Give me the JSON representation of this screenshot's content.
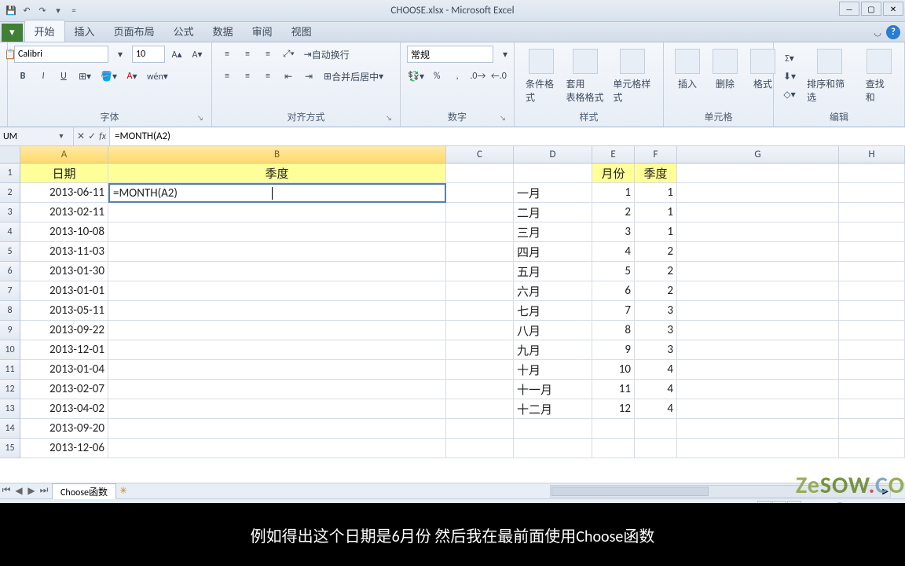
{
  "title": "CHOOSE.xlsx - Microsoft Excel",
  "tabs": {
    "file": "文件",
    "home": "开始",
    "insert": "插入",
    "layout": "页面布局",
    "formulas": "公式",
    "data": "数据",
    "review": "审阅",
    "view": "视图"
  },
  "ribbon": {
    "font": {
      "name": "Calibri",
      "size": "10",
      "label": "字体"
    },
    "align": {
      "wrap": "自动换行",
      "merge": "合并后居中",
      "label": "对齐方式"
    },
    "number": {
      "format": "常规",
      "label": "数字"
    },
    "styles": {
      "cond": "条件格式",
      "table": "套用\n表格格式",
      "cell": "单元格样式",
      "label": "样式"
    },
    "cells": {
      "insert": "插入",
      "delete": "删除",
      "format": "格式",
      "label": "单元格"
    },
    "editing": {
      "sort": "排序和筛选",
      "find": "查找和",
      "label": "编辑"
    }
  },
  "formula_bar": {
    "namebox": "UM",
    "formula": "=MONTH(A2)"
  },
  "columns": [
    "A",
    "B",
    "C",
    "D",
    "E",
    "F",
    "G",
    "H"
  ],
  "headers": {
    "A1": "日期",
    "B1": "季度",
    "E1": "月份",
    "F1": "季度"
  },
  "active_cell": {
    "ref": "B2",
    "value": "=MONTH(A2)"
  },
  "colA": [
    "2013-06-11",
    "2013-02-11",
    "2013-10-08",
    "2013-11-03",
    "2013-01-30",
    "2013-01-01",
    "2013-05-11",
    "2013-09-22",
    "2013-12-01",
    "2013-01-04",
    "2013-02-07",
    "2013-04-02",
    "2013-09-20",
    "2013-12-06"
  ],
  "colD": [
    "一月",
    "二月",
    "三月",
    "四月",
    "五月",
    "六月",
    "七月",
    "八月",
    "九月",
    "十月",
    "十一月",
    "十二月"
  ],
  "colE": [
    1,
    2,
    3,
    4,
    5,
    6,
    7,
    8,
    9,
    10,
    11,
    12
  ],
  "colF": [
    1,
    1,
    1,
    2,
    2,
    2,
    3,
    3,
    3,
    4,
    4,
    4
  ],
  "sheet_tab": "Choose函数",
  "zoom": "140%",
  "subtitle": "例如得出这个日期是6月份  然后我在最前面使用Choose函数",
  "watermark": "ZeSOW.CO"
}
